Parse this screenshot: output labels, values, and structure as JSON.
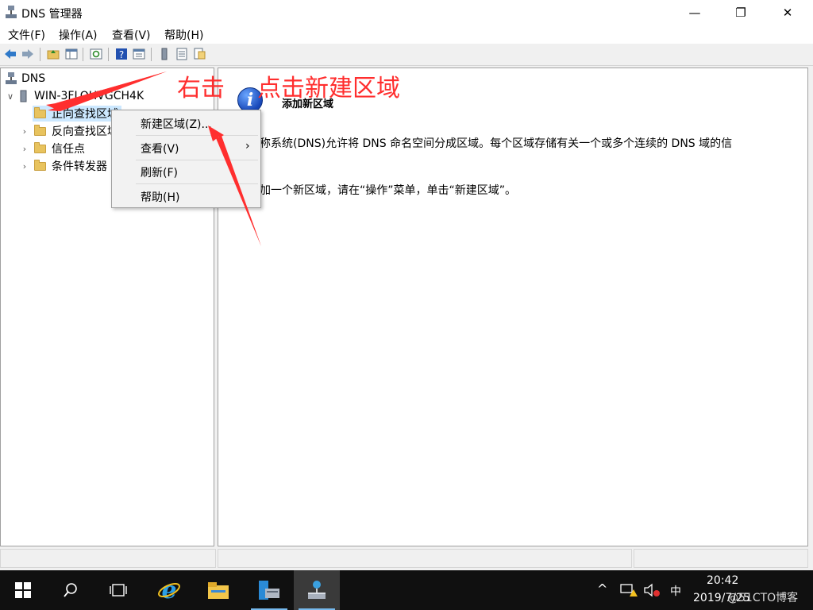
{
  "window": {
    "title": "DNS 管理器",
    "minimize_glyph": "—",
    "maximize_glyph": "❐",
    "close_glyph": "✕"
  },
  "menubar": [
    "文件(F)",
    "操作(A)",
    "查看(V)",
    "帮助(H)"
  ],
  "toolbar": [
    "back-icon",
    "forward-icon",
    "up-folder-icon",
    "show-hide-tree-icon",
    "refresh-icon",
    "help-icon",
    "properties-icon",
    "server-icon",
    "list-icon",
    "export-icon"
  ],
  "tree": {
    "root": "DNS",
    "server": "WIN-3FLOHVGCH4K",
    "children": [
      "正向查找区域",
      "反向查找区域",
      "信任点",
      "条件转发器"
    ]
  },
  "detail": {
    "heading": "添加新区域",
    "para1": "域名称系统(DNS)允许将 DNS 命名空间分成区域。每个区域存储有关一个或多个连续的 DNS 域的信",
    "para2": "要添加一个新区域，请在“操作”菜单，单击“新建区域”。"
  },
  "context_menu": {
    "new_zone": "新建区域(Z)...",
    "view": "查看(V)",
    "refresh": "刷新(F)",
    "help": "帮助(H)"
  },
  "annotations": {
    "right_click": "右击",
    "click_new_zone": "点击新建区域"
  },
  "taskbar": {
    "time": "20:42",
    "date": "2019/7/25",
    "ime": "中",
    "watermark": "@51CTO博客"
  },
  "colors": {
    "annotation_red": "#ff2e2e",
    "selection": "#cce8ff",
    "taskbar": "#101010"
  }
}
